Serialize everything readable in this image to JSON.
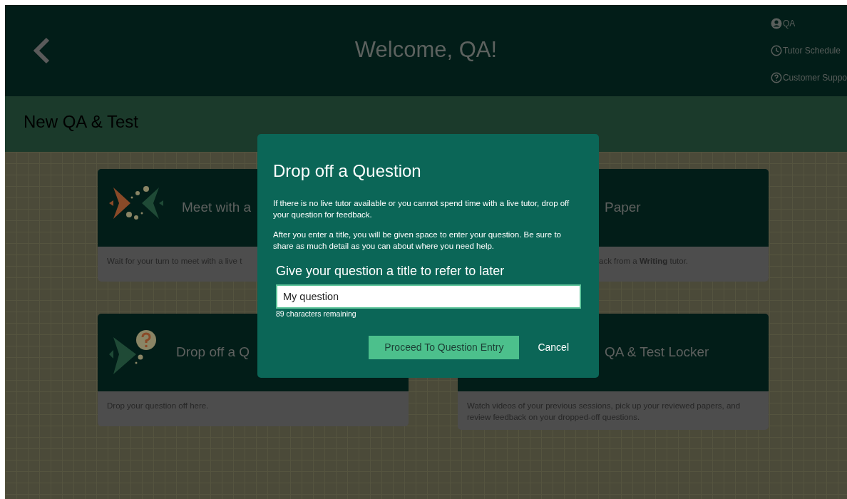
{
  "header": {
    "title": "Welcome, QA!",
    "menu": [
      {
        "label": "QA",
        "kind": "profile"
      },
      {
        "label": "Tutor Schedule",
        "kind": "schedule"
      },
      {
        "label": "Customer Suppo",
        "kind": "support"
      }
    ]
  },
  "subheader": {
    "title": "New QA & Test"
  },
  "cards": [
    {
      "title": "Meet with a",
      "description": "Wait for your turn to meet with a live t",
      "kind": "meet"
    },
    {
      "title": "Paper",
      "description": "ack from a **Writing** tutor.",
      "kind": "covered"
    },
    {
      "title": "Drop off a Q",
      "description": "Drop your question off here.",
      "kind": "question"
    },
    {
      "title": "QA & Test Locker",
      "description": "Watch videos of your previous sessions, pick up your reviewed papers, and review feedback on your dropped-off questions.",
      "kind": "title_covered"
    }
  ],
  "modal": {
    "title": "Drop off a Question",
    "paragraphs": [
      "If there is no live tutor available or you cannot spend time with a live tutor, drop off your question for feedback.",
      "After you enter a title, you will be given space to enter your question. Be sure to share as much detail as you can about where you need help."
    ],
    "field_label": "Give your question a title to refer to later",
    "field_value": "My question",
    "remaining": "89 characters remaining",
    "buttons": [
      {
        "label": "Proceed To Question Entry",
        "kind": "primary"
      },
      {
        "label": "Cancel",
        "kind": "link"
      }
    ]
  }
}
